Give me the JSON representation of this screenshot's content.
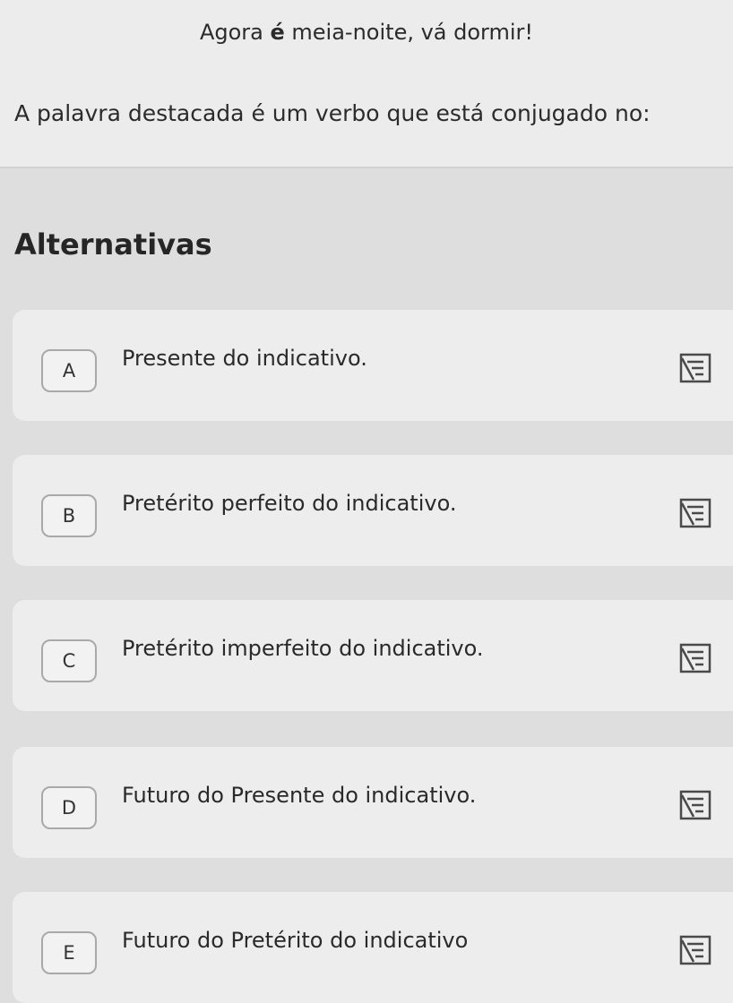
{
  "question": {
    "sentence_before": "Agora ",
    "sentence_highlight": "é",
    "sentence_after": " meia-noite, vá dormir!",
    "prompt": "A palavra destacada é um verbo que está conjugado no:"
  },
  "alternatives_title": "Alternativas",
  "options": [
    {
      "letter": "A",
      "text": "Presente do indicativo."
    },
    {
      "letter": "B",
      "text": "Pretérito perfeito do indicativo."
    },
    {
      "letter": "C",
      "text": "Pretérito imperfeito do indicativo."
    },
    {
      "letter": "D",
      "text": "Futuro do Presente do indicativo."
    },
    {
      "letter": "E",
      "text": "Futuro do Pretérito do indicativo"
    }
  ],
  "icons": {
    "strike": "strikethrough-option-icon"
  },
  "colors": {
    "background": "#dedede",
    "card": "#ededed",
    "text": "#2b2b2b",
    "letter_border": "#a9a9a9"
  }
}
